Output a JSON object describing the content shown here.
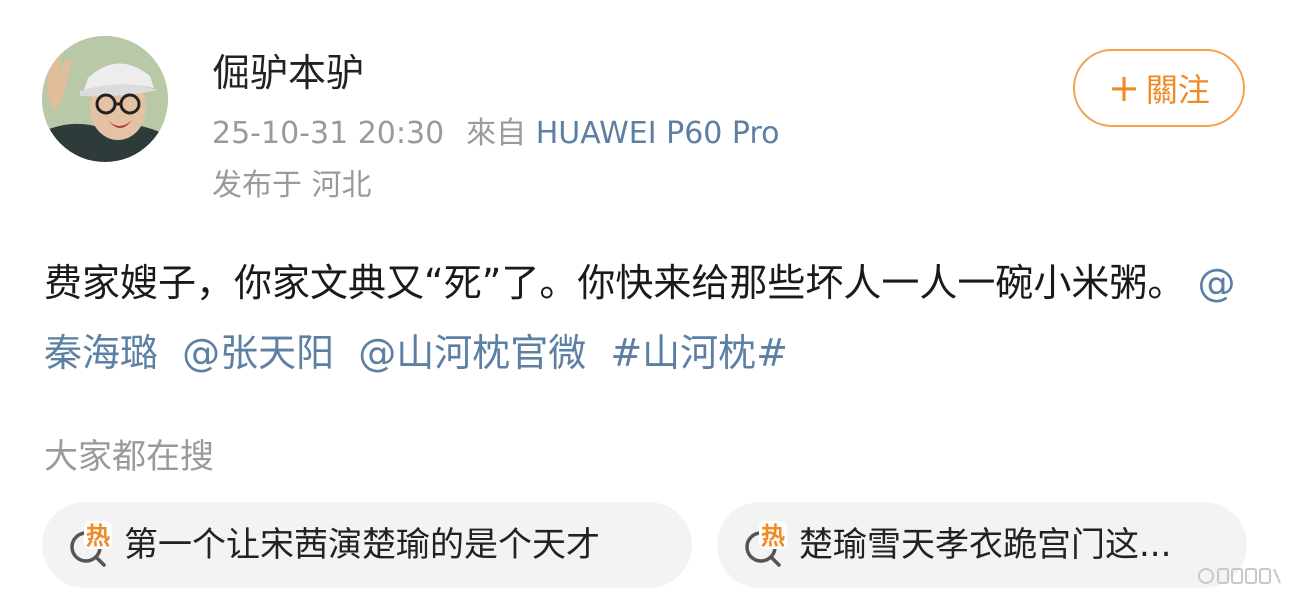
{
  "author": {
    "name": "倔驴本驴"
  },
  "meta": {
    "date": "25-10-31 20:30",
    "source_prefix": "來自",
    "source_device": "HUAWEI P60 Pro",
    "location": "发布于 河北"
  },
  "follow_button": {
    "plus": "+",
    "label": "關注"
  },
  "post": {
    "text": "费家嫂子，你家文典又“死”了。你快来给那些坏人一人一碗小米粥。",
    "mentions": [
      "@秦海璐",
      "@张天阳",
      "@山河枕官微"
    ],
    "hashtag": "#山河枕#"
  },
  "trending": {
    "title": "大家都在搜",
    "items": [
      {
        "icon": "hot-search-icon",
        "badge": "热",
        "text": "第一个让宋茜演楚瑜的是个天才"
      },
      {
        "icon": "hot-search-icon",
        "badge": "热",
        "text": "楚瑜雪天孝衣跪宫门这..."
      }
    ]
  },
  "colors": {
    "accent_orange": "#f08a24",
    "link_blue": "#5c7fa3",
    "muted_gray": "#9a9a9a",
    "chip_bg": "#f3f3f3"
  }
}
